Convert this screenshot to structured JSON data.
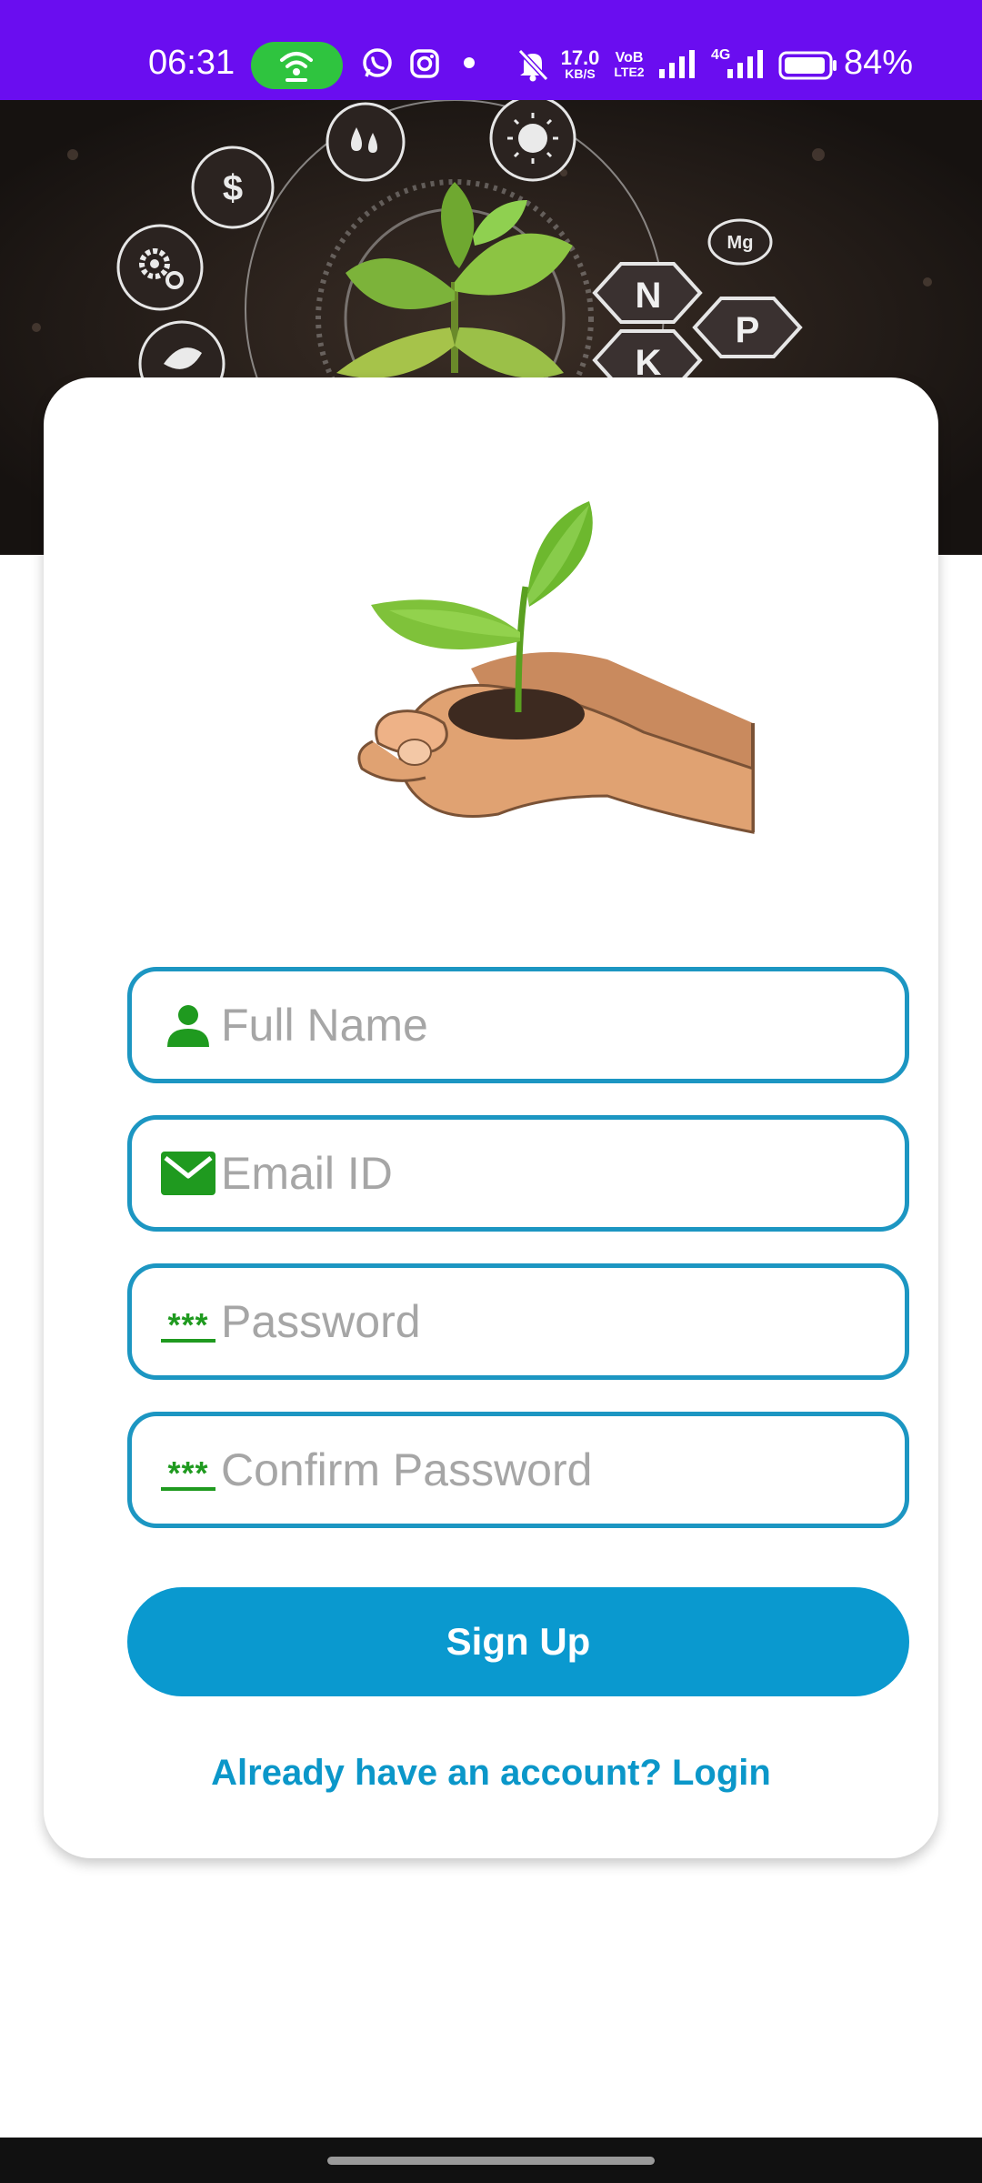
{
  "status_bar": {
    "time": "06:31",
    "net_speed_value": "17.0",
    "net_speed_unit": "KB/S",
    "volte_top": "VoB",
    "volte_bottom": "LTE2",
    "network_type": "4G",
    "battery_percent": "84%",
    "icons": [
      "hotspot-icon",
      "whatsapp-icon",
      "instagram-icon",
      "dot-icon",
      "mute-icon",
      "signal-icon",
      "signal-4g-icon",
      "battery-icon"
    ],
    "background": "#6a0df0"
  },
  "hero": {
    "labels": {
      "dollar": "$",
      "n": "N",
      "p": "P",
      "k": "K",
      "mg": "Mg"
    }
  },
  "form": {
    "full_name_placeholder": "Full Name",
    "email_placeholder": "Email ID",
    "password_placeholder": "Password",
    "confirm_password_placeholder": "Confirm Password",
    "password_icon_text": "***",
    "confirm_icon_text": "***"
  },
  "actions": {
    "signup_label": "Sign Up",
    "login_prompt": "Already have an account? Login"
  },
  "colors": {
    "accent": "#0a99cf",
    "field_border": "#1c96c2",
    "icon_green": "#1f9a1f"
  }
}
